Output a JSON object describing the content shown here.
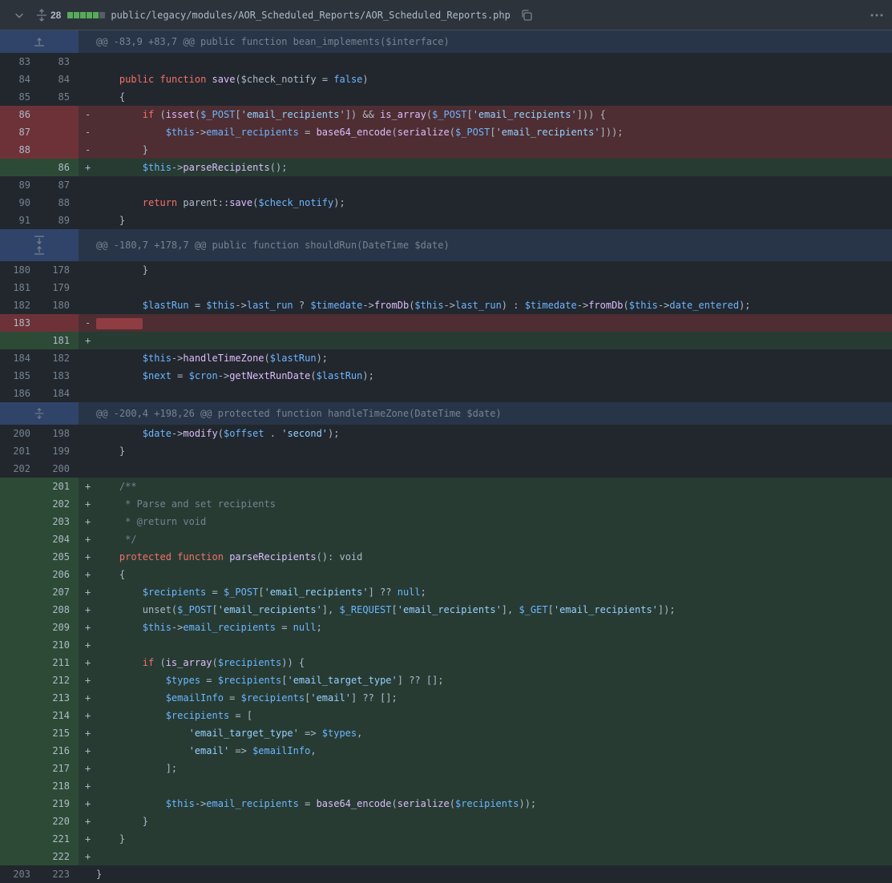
{
  "header": {
    "changes": "28",
    "filename": "public/legacy/modules/AOR_Scheduled_Reports/AOR_Scheduled_Reports.php",
    "stat_colors": [
      "#57ab5a",
      "#57ab5a",
      "#57ab5a",
      "#57ab5a",
      "#57ab5a",
      "#545d68"
    ]
  },
  "hunks": [
    "@@ -83,9 +83,7 @@ public function bean_implements($interface)",
    "@@ -180,7 +178,7 @@ public function shouldRun(DateTime $date)",
    "@@ -200,4 +198,26 @@ protected function handleTimeZone(DateTime $date)"
  ],
  "lines": {
    "l1": {
      "o": "83",
      "n": "83",
      "s": ""
    },
    "l2": {
      "o": "84",
      "n": "84",
      "s": ""
    },
    "l3": {
      "o": "85",
      "n": "85",
      "s": ""
    },
    "l4": {
      "o": "86",
      "n": "",
      "s": "-"
    },
    "l5": {
      "o": "87",
      "n": "",
      "s": "-"
    },
    "l6": {
      "o": "88",
      "n": "",
      "s": "-"
    },
    "l7": {
      "o": "",
      "n": "86",
      "s": "+"
    },
    "l8": {
      "o": "89",
      "n": "87",
      "s": ""
    },
    "l9": {
      "o": "90",
      "n": "88",
      "s": ""
    },
    "l10": {
      "o": "91",
      "n": "89",
      "s": ""
    },
    "m1": {
      "o": "180",
      "n": "178",
      "s": ""
    },
    "m2": {
      "o": "181",
      "n": "179",
      "s": ""
    },
    "m3": {
      "o": "182",
      "n": "180",
      "s": ""
    },
    "m4": {
      "o": "183",
      "n": "",
      "s": "-"
    },
    "m5": {
      "o": "",
      "n": "181",
      "s": "+"
    },
    "m6": {
      "o": "184",
      "n": "182",
      "s": ""
    },
    "m7": {
      "o": "185",
      "n": "183",
      "s": ""
    },
    "m8": {
      "o": "186",
      "n": "184",
      "s": ""
    },
    "n1": {
      "o": "200",
      "n": "198",
      "s": ""
    },
    "n2": {
      "o": "201",
      "n": "199",
      "s": ""
    },
    "n3": {
      "o": "202",
      "n": "200",
      "s": ""
    },
    "n4": {
      "o": "",
      "n": "201",
      "s": "+"
    },
    "n5": {
      "o": "",
      "n": "202",
      "s": "+"
    },
    "n6": {
      "o": "",
      "n": "203",
      "s": "+"
    },
    "n7": {
      "o": "",
      "n": "204",
      "s": "+"
    },
    "n8": {
      "o": "",
      "n": "205",
      "s": "+"
    },
    "n9": {
      "o": "",
      "n": "206",
      "s": "+"
    },
    "n10": {
      "o": "",
      "n": "207",
      "s": "+"
    },
    "n11": {
      "o": "",
      "n": "208",
      "s": "+"
    },
    "n12": {
      "o": "",
      "n": "209",
      "s": "+"
    },
    "n13": {
      "o": "",
      "n": "210",
      "s": "+"
    },
    "n14": {
      "o": "",
      "n": "211",
      "s": "+"
    },
    "n15": {
      "o": "",
      "n": "212",
      "s": "+"
    },
    "n16": {
      "o": "",
      "n": "213",
      "s": "+"
    },
    "n17": {
      "o": "",
      "n": "214",
      "s": "+"
    },
    "n18": {
      "o": "",
      "n": "215",
      "s": "+"
    },
    "n19": {
      "o": "",
      "n": "216",
      "s": "+"
    },
    "n20": {
      "o": "",
      "n": "217",
      "s": "+"
    },
    "n21": {
      "o": "",
      "n": "218",
      "s": "+"
    },
    "n22": {
      "o": "",
      "n": "219",
      "s": "+"
    },
    "n23": {
      "o": "",
      "n": "220",
      "s": "+"
    },
    "n24": {
      "o": "",
      "n": "221",
      "s": "+"
    },
    "n25": {
      "o": "",
      "n": "222",
      "s": "+"
    },
    "n26": {
      "o": "203",
      "n": "223",
      "s": ""
    }
  },
  "t": {
    "public": "public",
    "function": "function",
    "protected": "protected",
    "if": "if",
    "return": "return",
    "false": "false",
    "null": "null",
    "save": "save",
    "check_notify_param": "$check_notify = ",
    "open_brace": "{",
    "close_brace": "}",
    "isset": "isset",
    "is_array": "is_array",
    "post": "$_POST",
    "get": "$_GET",
    "request": "$_REQUEST",
    "str_email_recipients": "'email_recipients'",
    "str_email_target_type": "'email_target_type'",
    "str_email": "'email'",
    "str_second": "'second'",
    "this": "$this",
    "email_recipients_prop": "email_recipients",
    "base64_encode": "base64_encode",
    "serialize": "serialize",
    "parseRecipients": "parseRecipients",
    "parent_save": "parent::",
    "check_notify": "$check_notify",
    "lastRun": "$lastRun",
    "last_run": "last_run",
    "timedate": "$timedate",
    "fromDb": "fromDb",
    "date_entered": "date_entered",
    "handleTimeZone": "handleTimeZone",
    "next": "$next",
    "cron": "$cron",
    "getNextRunDate": "getNextRunDate",
    "date": "$date",
    "modify": "modify",
    "offset": "$offset",
    "recipients": "$recipients",
    "types": "$types",
    "emailInfo": "$emailInfo",
    "unset": "unset",
    "c1": "/**",
    "c2": " * Parse and set recipients",
    "c3": " * @return void",
    "c4": " */",
    "void": "void"
  }
}
